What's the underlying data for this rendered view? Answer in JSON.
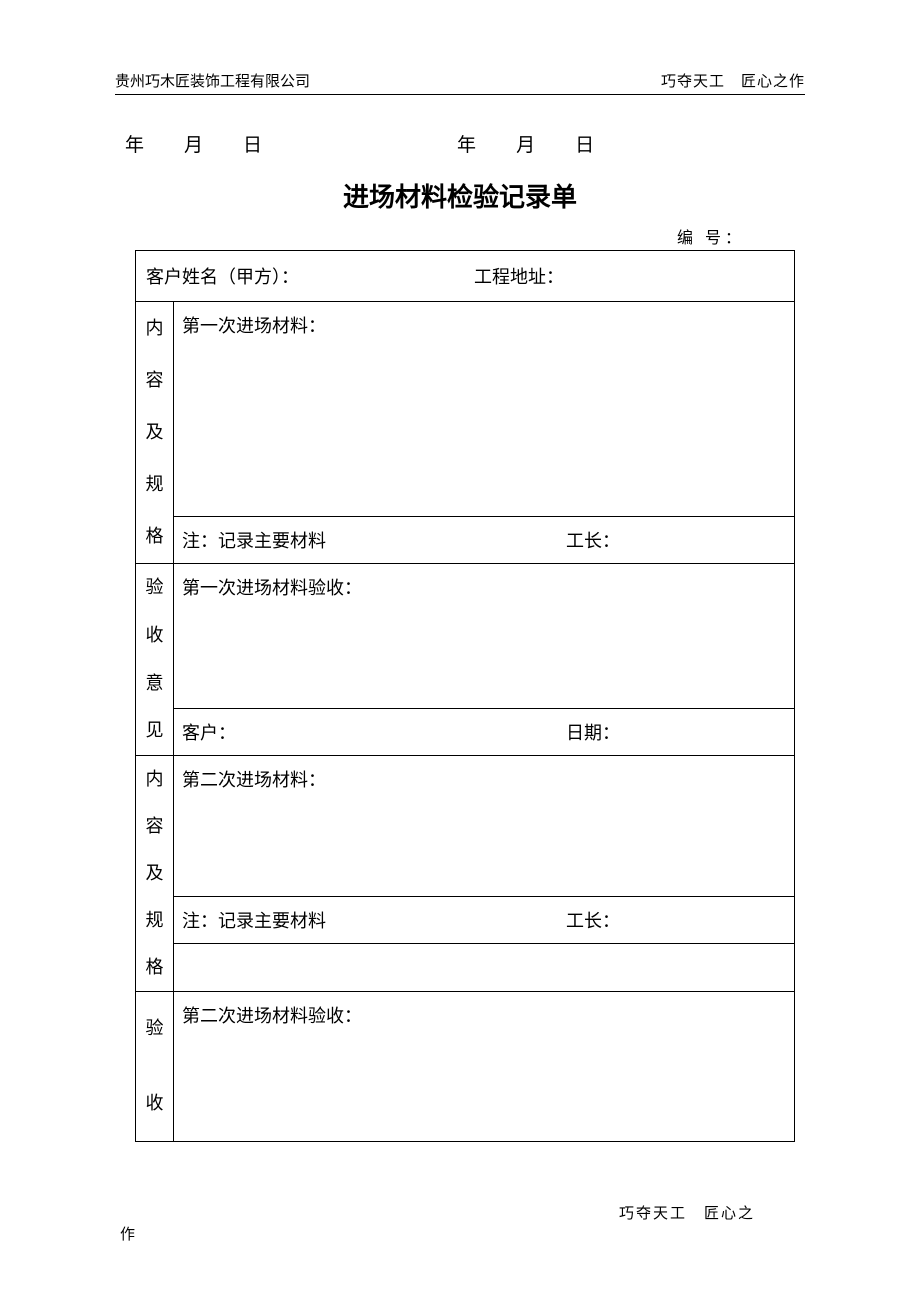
{
  "header": {
    "company": "贵州巧木匠装饰工程有限公司",
    "slogan": "巧夺天工　匠心之作"
  },
  "dates": {
    "year": "年",
    "month": "月",
    "day": "日"
  },
  "title": "进场材料检验记录单",
  "serialLabel": "编 号：",
  "row1": {
    "customerLabel": "客户姓名（甲方）：",
    "addressLabel": "工程地址："
  },
  "section1": {
    "vlabel": {
      "c1": "内",
      "c2": "容",
      "c3": "及",
      "c4": "规",
      "c5": "格"
    },
    "material": "第一次进场材料：",
    "note": "注：记录主要材料",
    "foreman": "工长："
  },
  "section2": {
    "vlabel": {
      "c1": "验",
      "c2": "收",
      "c3": "意",
      "c4": "见"
    },
    "acceptance": "第一次进场材料验收：",
    "customer": "客户：",
    "date": "日期："
  },
  "section3": {
    "vlabel": {
      "c1": "内",
      "c2": "容",
      "c3": "及",
      "c4": "规",
      "c5": "格"
    },
    "material": "第二次进场材料：",
    "note": "注：记录主要材料",
    "foreman": "工长："
  },
  "section4": {
    "vlabel": {
      "c1": "验",
      "c2": "收"
    },
    "acceptance": "第二次进场材料验收："
  },
  "footer": {
    "line1": "巧夺天工　匠心之",
    "line2": "作"
  }
}
